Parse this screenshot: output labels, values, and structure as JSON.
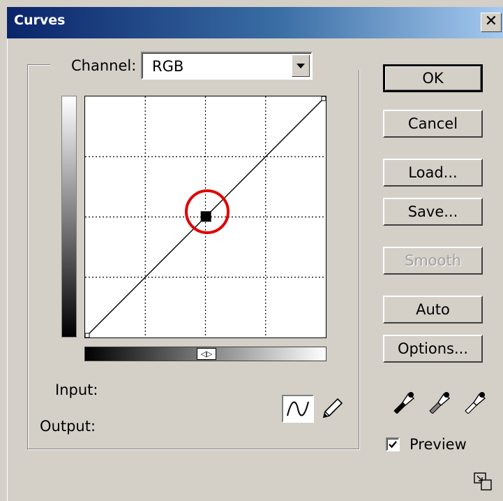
{
  "window": {
    "title": "Curves",
    "close_glyph": "✕"
  },
  "channel": {
    "label": "Channel:",
    "value": "RGB"
  },
  "graph": {
    "grid_divisions": 4,
    "curve_points": [
      {
        "input": 0,
        "output": 0
      },
      {
        "input": 128,
        "output": 128
      },
      {
        "input": 255,
        "output": 255
      }
    ],
    "selected_point_index": 1,
    "highlight_color": "#e00000",
    "gradient_toggle": "◁▷"
  },
  "readout": {
    "input_label": "Input:",
    "output_label": "Output:"
  },
  "tools": {
    "curve_tool": "curve-icon",
    "pencil_tool": "pencil-icon"
  },
  "buttons": {
    "ok": "OK",
    "cancel": "Cancel",
    "load": "Load...",
    "save": "Save...",
    "smooth": "Smooth",
    "auto": "Auto",
    "options": "Options..."
  },
  "eyedroppers": [
    "black-eyedropper-icon",
    "gray-eyedropper-icon",
    "white-eyedropper-icon"
  ],
  "preview": {
    "label": "Preview",
    "checked": true
  },
  "expand_icon": "expand-icon"
}
